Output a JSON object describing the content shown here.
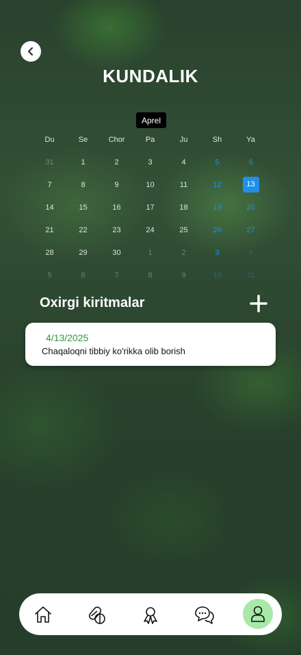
{
  "header": {
    "title": "KUNDALIK",
    "back_icon": "chevron-left-icon"
  },
  "calendar": {
    "month": "Aprel",
    "weekdays": [
      "Du",
      "Se",
      "Chor",
      "Pa",
      "Ju",
      "Sh",
      "Ya"
    ],
    "today": "13",
    "weeks": [
      [
        "31",
        "1",
        "2",
        "3",
        "4",
        "5",
        "6"
      ],
      [
        "7",
        "8",
        "9",
        "10",
        "11",
        "12",
        "13"
      ],
      [
        "14",
        "15",
        "16",
        "17",
        "18",
        "19",
        "20"
      ],
      [
        "21",
        "22",
        "23",
        "24",
        "25",
        "26",
        "27"
      ],
      [
        "28",
        "29",
        "30",
        "1",
        "2",
        "3",
        "4"
      ],
      [
        "5",
        "6",
        "7",
        "8",
        "9",
        "10",
        "11"
      ]
    ],
    "accent_color": "#1e90e8"
  },
  "entries_section": {
    "title": "Oxirgi kiritmalar",
    "add_icon": "plus-icon",
    "entries": [
      {
        "date": "4/13/2025",
        "text": "Chaqaloqni tibbiy ko'rikka olib borish"
      }
    ]
  },
  "bottom_nav": {
    "items": [
      {
        "icon": "home-icon"
      },
      {
        "icon": "pills-icon"
      },
      {
        "icon": "award-icon"
      },
      {
        "icon": "chat-icon"
      },
      {
        "icon": "user-icon",
        "active": true
      }
    ],
    "active_color": "#a8e8a8"
  }
}
